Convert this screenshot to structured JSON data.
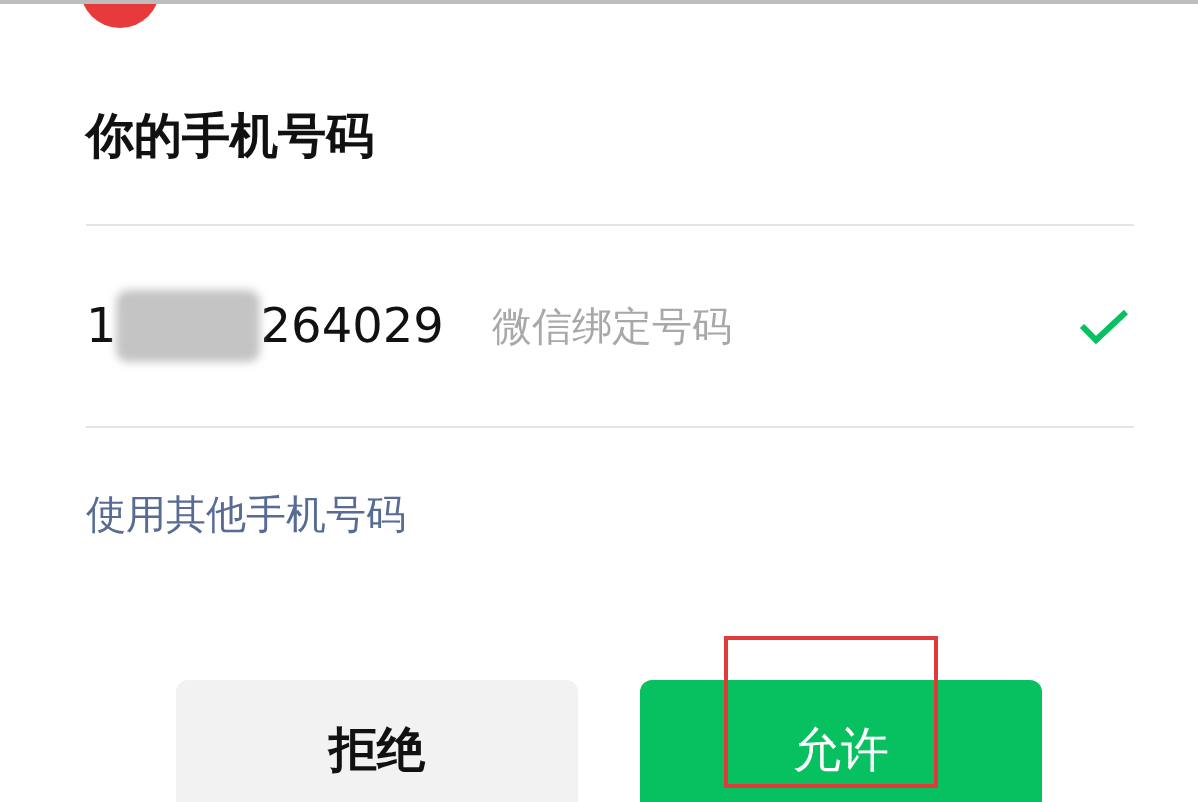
{
  "heading": "你的手机号码",
  "phone": {
    "number_start": "1",
    "number_end": "264029",
    "label": "微信绑定号码",
    "selected": true
  },
  "other_phone_link": "使用其他手机号码",
  "buttons": [
    {
      "label": "拒绝",
      "kind": "secondary"
    },
    {
      "label": "允许",
      "kind": "primary"
    }
  ]
}
